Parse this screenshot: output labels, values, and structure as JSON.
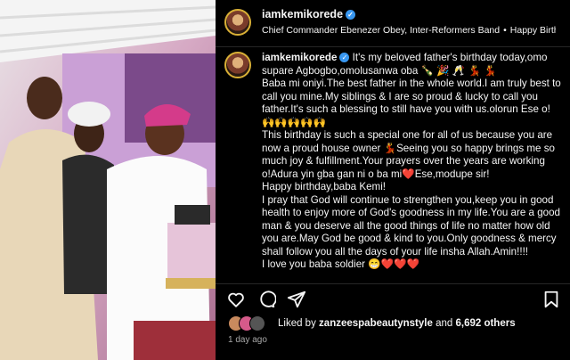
{
  "post": {
    "username": "iamkemikorede",
    "audio": {
      "artist": "Chief Commander Ebenezer Obey, Inter-Reformers Band",
      "separator": "•",
      "track": "Happy Birthday"
    },
    "caption": {
      "username": "iamkemikorede",
      "lines": [
        "It's my beloved father's birthday today,omo supare Agbogbo,omolusanwa oba 🍾 🎉 🥂 💃 💃",
        "Baba mi oniyi.The best father in the whole world.I am truly best to call you mine.My siblings & I are so proud & lucky to call you father.It's such a blessing to still have you with us.olorun Ese o! 🙌🙌🙌🙌🙌",
        "This birthday is such a special one for all of us because you are now a proud house owner 💃Seeing you so happy brings me so much joy & fulfillment.Your prayers over the years are working o!Adura yin gba gan ni o ba mi❤️Ese,modupe sir!",
        "Happy birthday,baba Kemi!",
        "I pray that God will continue to strengthen you,keep you in good health to enjoy more of God's goodness in my life.You are a good man & you deserve all the good things of life no matter how old you are.May God be good & kind to you.Only goodness & mercy shall follow you all the days of your life insha Allah.Amin!!!!",
        "I love you baba soldier 😁❤️❤️❤️"
      ]
    },
    "likes": {
      "prefix": "Liked by",
      "user": "zanzeespabeautynstyle",
      "and": "and",
      "count": "6,692 others"
    },
    "timestamp": "1 day ago"
  },
  "icons": {
    "like": "heart-icon",
    "comment": "comment-icon",
    "share": "share-icon",
    "save": "bookmark-icon"
  },
  "colors": {
    "background": "#000000",
    "text": "#f5f5f5",
    "muted": "#a8a8a8",
    "verified": "#3897f0",
    "divider": "#262626"
  }
}
